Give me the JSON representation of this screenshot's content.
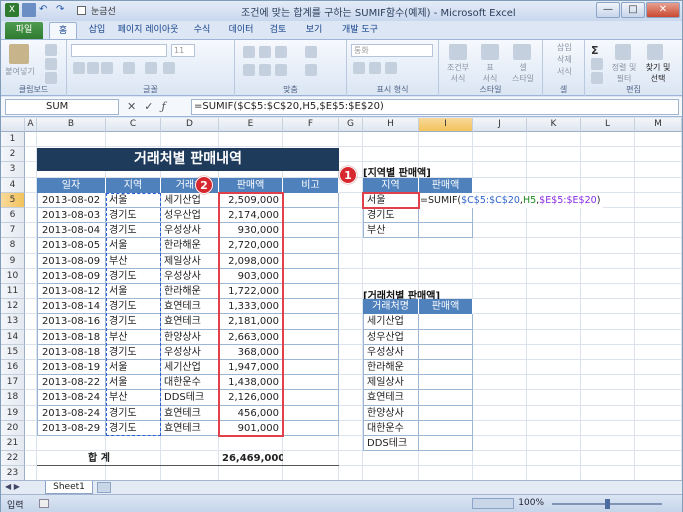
{
  "window": {
    "title": "조건에 맞는 합계를 구하는 SUMIF함수(예제) - Microsoft Excel",
    "qat_label": "눈금선",
    "buttons": [
      "—",
      "□",
      "✕"
    ]
  },
  "tabs": [
    "파일",
    "홈",
    "삽입",
    "페이지 레이아웃",
    "수식",
    "데이터",
    "검토",
    "보기",
    "개발 도구"
  ],
  "ribbon": {
    "groups": [
      "클립보드",
      "글꼴",
      "맞춤",
      "표시 형식",
      "스타일",
      "셀",
      "편집"
    ],
    "paste": "붙여넣기",
    "font_size": "11",
    "number_format": "통화",
    "cond_format": "조건부\n서식",
    "table_format": "표\n서식",
    "cell_style": "셀\n스타일",
    "insert": "삽입",
    "delete": "삭제",
    "format": "서식",
    "sort": "정렬 및\n필터",
    "find": "찾기 및\n선택"
  },
  "formula_bar": {
    "name_box": "SUM",
    "formula": "=SUMIF($C$5:$C$20,H5,$E$5:$E$20)"
  },
  "columns": [
    "A",
    "B",
    "C",
    "D",
    "E",
    "F",
    "G",
    "H",
    "I",
    "J",
    "K",
    "L",
    "M"
  ],
  "rows": [
    "1",
    "2",
    "3",
    "4",
    "5",
    "6",
    "7",
    "8",
    "9",
    "10",
    "11",
    "12",
    "13",
    "14",
    "15",
    "16",
    "17",
    "18",
    "19",
    "20",
    "21",
    "22",
    "23"
  ],
  "sheet": {
    "title": "거래처별 판매내역",
    "headers": [
      "일자",
      "지역",
      "거래처",
      "판매액",
      "비고"
    ],
    "records": [
      [
        "2013-08-02",
        "서울",
        "세기산업",
        "2,509,000"
      ],
      [
        "2013-08-03",
        "경기도",
        "성우산업",
        "2,174,000"
      ],
      [
        "2013-08-04",
        "경기도",
        "우성상사",
        "930,000"
      ],
      [
        "2013-08-05",
        "서울",
        "한라해운",
        "2,720,000"
      ],
      [
        "2013-08-09",
        "부산",
        "제일상사",
        "2,098,000"
      ],
      [
        "2013-08-09",
        "경기도",
        "우성상사",
        "903,000"
      ],
      [
        "2013-08-12",
        "서울",
        "한라해운",
        "1,722,000"
      ],
      [
        "2013-08-14",
        "경기도",
        "효연테크",
        "1,333,000"
      ],
      [
        "2013-08-16",
        "경기도",
        "효연테크",
        "2,181,000"
      ],
      [
        "2013-08-18",
        "부산",
        "한양상사",
        "2,663,000"
      ],
      [
        "2013-08-18",
        "경기도",
        "우성상사",
        "368,000"
      ],
      [
        "2013-08-19",
        "서울",
        "세기산업",
        "1,947,000"
      ],
      [
        "2013-08-22",
        "서울",
        "대한운수",
        "1,438,000"
      ],
      [
        "2013-08-24",
        "부산",
        "DDS테크",
        "2,126,000"
      ],
      [
        "2013-08-24",
        "경기도",
        "효연테크",
        "456,000"
      ],
      [
        "2013-08-29",
        "경기도",
        "효연테크",
        "901,000"
      ]
    ],
    "total_label": "합  계",
    "total_value": "26,469,000"
  },
  "region_summary": {
    "label": "[지역별 판매액]",
    "headers": [
      "지역",
      "판매액"
    ],
    "rows": [
      "서울",
      "경기도",
      "부산"
    ],
    "editing_formula_parts": {
      "prefix": "=SUMIF(",
      "range": "$C$5:$C$20",
      "sep1": ",",
      "crit": "H5",
      "sep2": ",",
      "sum": "$E$5:$E$20",
      "suffix": ")"
    }
  },
  "client_summary": {
    "label": "[거래처별 판매액]",
    "headers": [
      "거래처명",
      "판매액"
    ],
    "rows": [
      "세기산업",
      "성우산업",
      "우성상사",
      "한라해운",
      "제일상사",
      "효연테크",
      "한양상사",
      "대한운수",
      "DDS테크"
    ]
  },
  "badges": [
    "1",
    "2"
  ],
  "sheet_tab": "Sheet1",
  "status": {
    "mode": "입력",
    "zoom": "100%"
  },
  "colors": {
    "header_blue": "#4f81bd",
    "banner": "#1f3b5c",
    "highlight": "#e0404a",
    "range_blue": "#3366cc",
    "crit_green": "#1a8a1a",
    "sum_purple": "#8a2be2"
  }
}
